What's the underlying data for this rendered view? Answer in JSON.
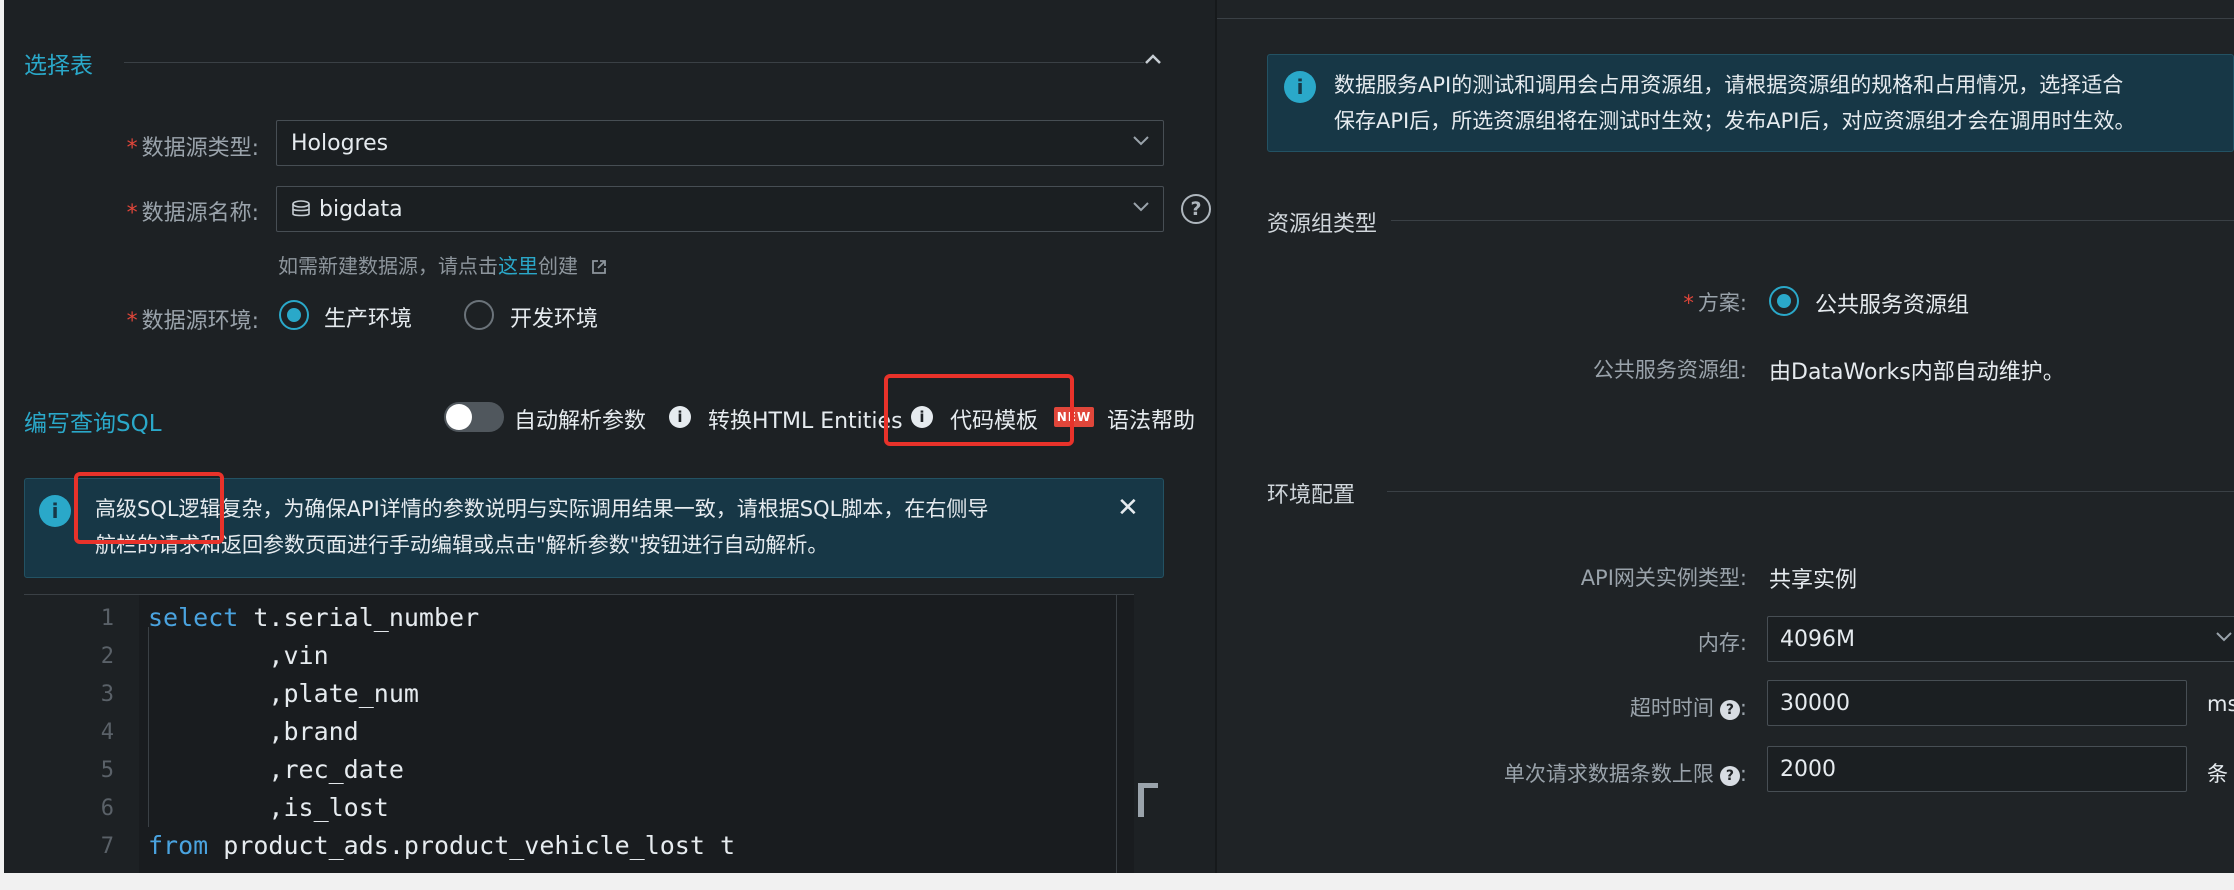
{
  "left": {
    "select_table": {
      "title": "选择表",
      "datasource_type": {
        "label": "数据源类型:",
        "value": "Hologres"
      },
      "datasource_name": {
        "label": "数据源名称:",
        "value": "bigdata"
      },
      "create_hint": {
        "prefix": "如需新建数据源，请点击",
        "link": "这里",
        "suffix": "创建"
      },
      "env": {
        "label": "数据源环境:",
        "options": [
          "生产环境",
          "开发环境"
        ],
        "selected": "生产环境"
      }
    },
    "sql": {
      "title": "编写查询SQL",
      "toolbar": {
        "auto_parse": "自动解析参数",
        "html_entities": "转换HTML Entities",
        "code_template": "代码模板",
        "new_badge": "NEW",
        "syntax_help": "语法帮助"
      },
      "notice": {
        "line1": "高级SQL逻辑复杂，为确保API详情的参数说明与实际调用结果一致，请根据SQL脚本，在右侧导",
        "line2": "航栏的请求和返回参数页面进行手动编辑或点击\"解析参数\"按钮进行自动解析。"
      },
      "code_lines": [
        {
          "n": "1",
          "kw": "select",
          "rest": " t.serial_number"
        },
        {
          "n": "2",
          "kw": "",
          "rest": "        ,vin"
        },
        {
          "n": "3",
          "kw": "",
          "rest": "        ,plate_num"
        },
        {
          "n": "4",
          "kw": "",
          "rest": "        ,brand"
        },
        {
          "n": "5",
          "kw": "",
          "rest": "        ,rec_date"
        },
        {
          "n": "6",
          "kw": "",
          "rest": "        ,is_lost"
        },
        {
          "n": "7",
          "kw": "from",
          "rest": " product_ads.product_vehicle_lost t"
        }
      ]
    }
  },
  "right": {
    "notice": {
      "line1": "数据服务API的测试和调用会占用资源组，请根据资源组的规格和占用情况，选择适合",
      "line2": "保存API后，所选资源组将在测试时生效；发布API后，对应资源组才会在调用时生效。"
    },
    "resource_group": {
      "title": "资源组类型",
      "plan": {
        "label": "方案:",
        "value": "公共服务资源组"
      },
      "public": {
        "label": "公共服务资源组:",
        "value": "由DataWorks内部自动维护。"
      }
    },
    "env_config": {
      "title": "环境配置",
      "gateway": {
        "label": "API网关实例类型:",
        "value": "共享实例"
      },
      "memory": {
        "label": "内存:",
        "value": "4096M"
      },
      "timeout": {
        "label": "超时时间",
        "value": "30000",
        "unit": "ms"
      },
      "limit": {
        "label": "单次请求数据条数上限",
        "value": "2000",
        "unit": "条"
      }
    }
  }
}
